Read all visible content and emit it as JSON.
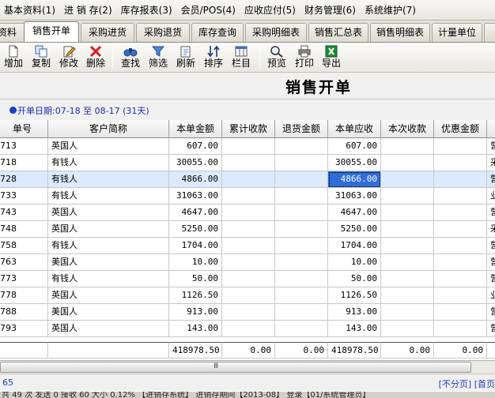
{
  "menu": [
    "基本资料(1)",
    "进 销 存(2)",
    "库存报表(3)",
    "会员/POS(4)",
    "应收应付(5)",
    "财务管理(6)",
    "系统维护(7)"
  ],
  "tabs": [
    "资料",
    "销售开单",
    "采购进货",
    "采购退货",
    "库存查询",
    "采购明细表",
    "销售汇总表",
    "销售明细表",
    "计量单位"
  ],
  "active_tab": "销售开单",
  "toolbar": {
    "add": "增加",
    "copy": "复制",
    "edit": "修改",
    "delete": "删除",
    "find": "查找",
    "filter": "筛选",
    "refresh": "刷新",
    "sort": "排序",
    "columns": "栏目",
    "preview": "预览",
    "print": "打印",
    "export": "导出"
  },
  "form_title": "销售开单",
  "date_range": "开单日期:07-18 至 08-17 (31天)",
  "columns": {
    "order_no": "单号",
    "customer": "客户简称",
    "amount": "本单金额",
    "cum_received": "累计收款",
    "returned": "退货金额",
    "receivable": "本单应收",
    "this_received": "本次收款",
    "discount": "优惠金额"
  },
  "rows": [
    {
      "no": "713",
      "customer": "英国人",
      "amount": "607.00",
      "receivable": "607.00",
      "tail": "营"
    },
    {
      "no": "718",
      "customer": "有钱人",
      "amount": "30055.00",
      "receivable": "30055.00",
      "tail": "采"
    },
    {
      "no": "728",
      "customer": "有钱人",
      "amount": "4866.00",
      "receivable": "4866.00",
      "tail": "营"
    },
    {
      "no": "733",
      "customer": "有钱人",
      "amount": "31063.00",
      "receivable": "31063.00",
      "tail": "业"
    },
    {
      "no": "743",
      "customer": "英国人",
      "amount": "4647.00",
      "receivable": "4647.00",
      "tail": "营"
    },
    {
      "no": "748",
      "customer": "英国人",
      "amount": "5250.00",
      "receivable": "5250.00",
      "tail": "采"
    },
    {
      "no": "758",
      "customer": "有钱人",
      "amount": "1704.00",
      "receivable": "1704.00",
      "tail": "营"
    },
    {
      "no": "763",
      "customer": "美国人",
      "amount": "10.00",
      "receivable": "10.00",
      "tail": "营"
    },
    {
      "no": "773",
      "customer": "有钱人",
      "amount": "50.00",
      "receivable": "50.00",
      "tail": "营"
    },
    {
      "no": "778",
      "customer": "英国人",
      "amount": "1126.50",
      "receivable": "1126.50",
      "tail": "业"
    },
    {
      "no": "788",
      "customer": "美国人",
      "amount": "913.00",
      "receivable": "913.00",
      "tail": "营"
    },
    {
      "no": "793",
      "customer": "英国人",
      "amount": "143.00",
      "receivable": "143.00",
      "tail": "营"
    }
  ],
  "totals": {
    "amount": "418978.50",
    "cum_received": "0.00",
    "returned": "0.00",
    "receivable": "418978.50",
    "this_received": "0.00",
    "discount": "0.00"
  },
  "scroll_grip": "Ⅲ",
  "pager": {
    "count": "65",
    "links": "[不分页] [首页"
  },
  "status": "共 49 次 发送 0 接收 60 大小 0.12%  【进销存系统】 进销存期间【2013-08】 登录【01/系统管理员】"
}
